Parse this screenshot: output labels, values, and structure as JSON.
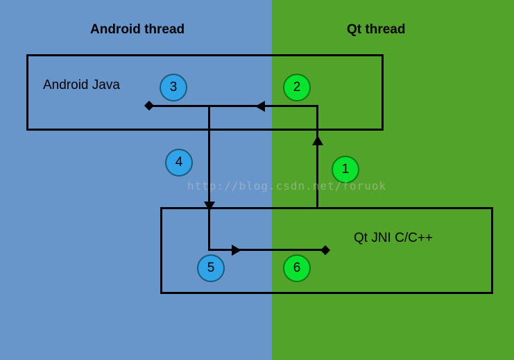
{
  "headers": {
    "left": "Android thread",
    "right": "Qt thread"
  },
  "boxes": {
    "top": {
      "label": "Android Java"
    },
    "bottom": {
      "label": "Qt JNI C/C++"
    }
  },
  "circles": {
    "c1": {
      "num": "1",
      "color": "green"
    },
    "c2": {
      "num": "2",
      "color": "green"
    },
    "c3": {
      "num": "3",
      "color": "blue"
    },
    "c4": {
      "num": "4",
      "color": "blue"
    },
    "c5": {
      "num": "5",
      "color": "blue"
    },
    "c6": {
      "num": "6",
      "color": "green"
    }
  },
  "watermark": "http://blog.csdn.net/foruok"
}
